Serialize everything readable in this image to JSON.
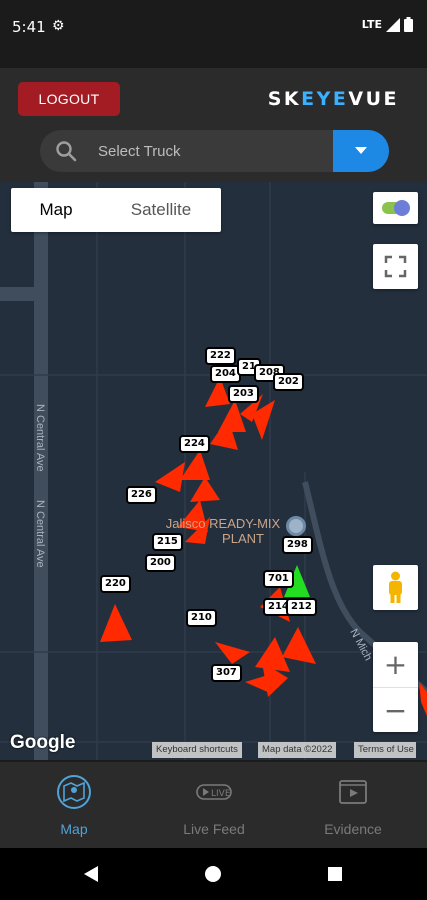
{
  "status_bar": {
    "time": "5:41",
    "network": "LTE"
  },
  "header": {
    "logout_label": "LOGOUT",
    "brand": {
      "part1": "SK",
      "part2": "EYE",
      "part3": "VUE"
    }
  },
  "search": {
    "placeholder": "Select Truck"
  },
  "map": {
    "type_tabs": {
      "map": "Map",
      "satellite": "Satellite"
    },
    "road_labels": {
      "central_1": "N Central Ave",
      "central_2": "N Central Ave",
      "mich": "N Mich"
    },
    "poi": {
      "line1": "Jalisco READY-MIX",
      "line2": "PLANT"
    },
    "trucks": [
      "222",
      "204",
      "21",
      "208",
      "202",
      "203",
      "224",
      "226",
      "215",
      "200",
      "220",
      "298",
      "701",
      "214",
      "212",
      "210",
      "307"
    ],
    "google": "Google",
    "attribution": {
      "shortcuts": "Keyboard shortcuts",
      "data": "Map data ©2022",
      "terms": "Terms of Use"
    },
    "zoom": {
      "in": "+",
      "out": "−"
    },
    "colors": {
      "truck_marker": "#ff2a00",
      "selected_marker": "#22dd22",
      "map_bg": "#232f3d"
    }
  },
  "bottom_nav": {
    "items": [
      {
        "label": "Map",
        "active": true
      },
      {
        "label": "Live Feed",
        "active": false
      },
      {
        "label": "Evidence",
        "active": false
      }
    ],
    "colors": {
      "active": "#4fa3d9",
      "inactive": "#7a7a7a"
    }
  }
}
